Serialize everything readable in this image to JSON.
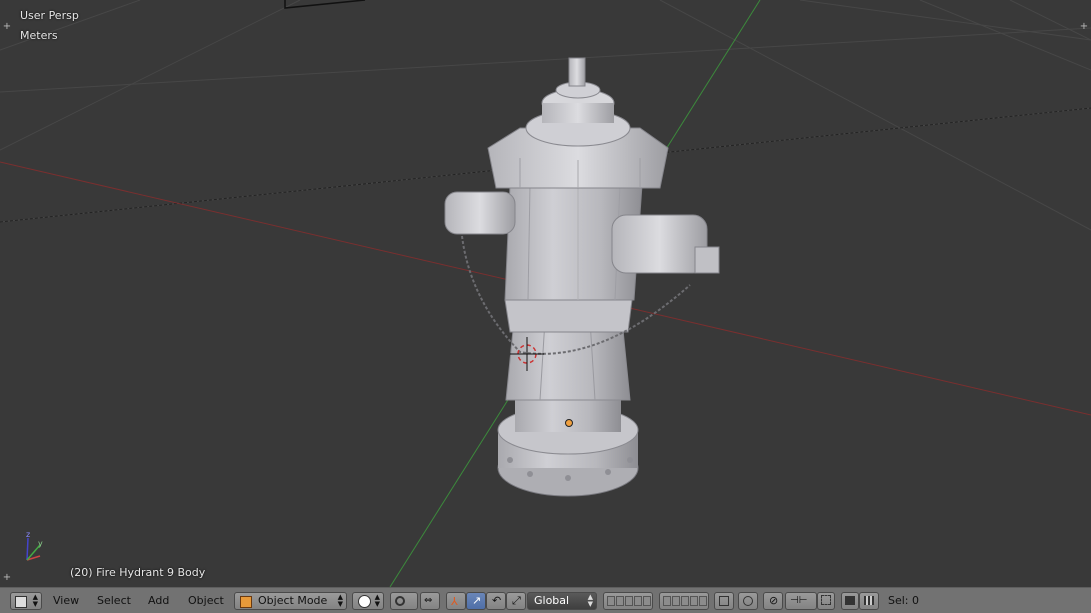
{
  "viewport": {
    "view_name": "User Persp",
    "units": "Meters",
    "object_info": "(20) Fire Hydrant 9 Body"
  },
  "header": {
    "menu_view": "View",
    "menu_select": "Select",
    "menu_add": "Add",
    "menu_object": "Object",
    "mode": "Object Mode",
    "orientation": "Global",
    "selection_count": "Sel: 0"
  },
  "icons": [
    "editor-type-icon",
    "shading-sphere-icon",
    "pivot-icon",
    "manipulator-icon",
    "translate-icon",
    "rotate-icon",
    "scale-icon",
    "layers-icon",
    "lock-icon",
    "proportional-icon",
    "snap-icon",
    "snap-target-icon",
    "render-icon",
    "clapper-icon",
    "axis-gizmo"
  ],
  "colors": {
    "x_axis": "#8a2a2a",
    "y_axis": "#3f8a3f",
    "grid": "#4a4a4a",
    "header": "#727272",
    "model": "#c8c8cc"
  }
}
